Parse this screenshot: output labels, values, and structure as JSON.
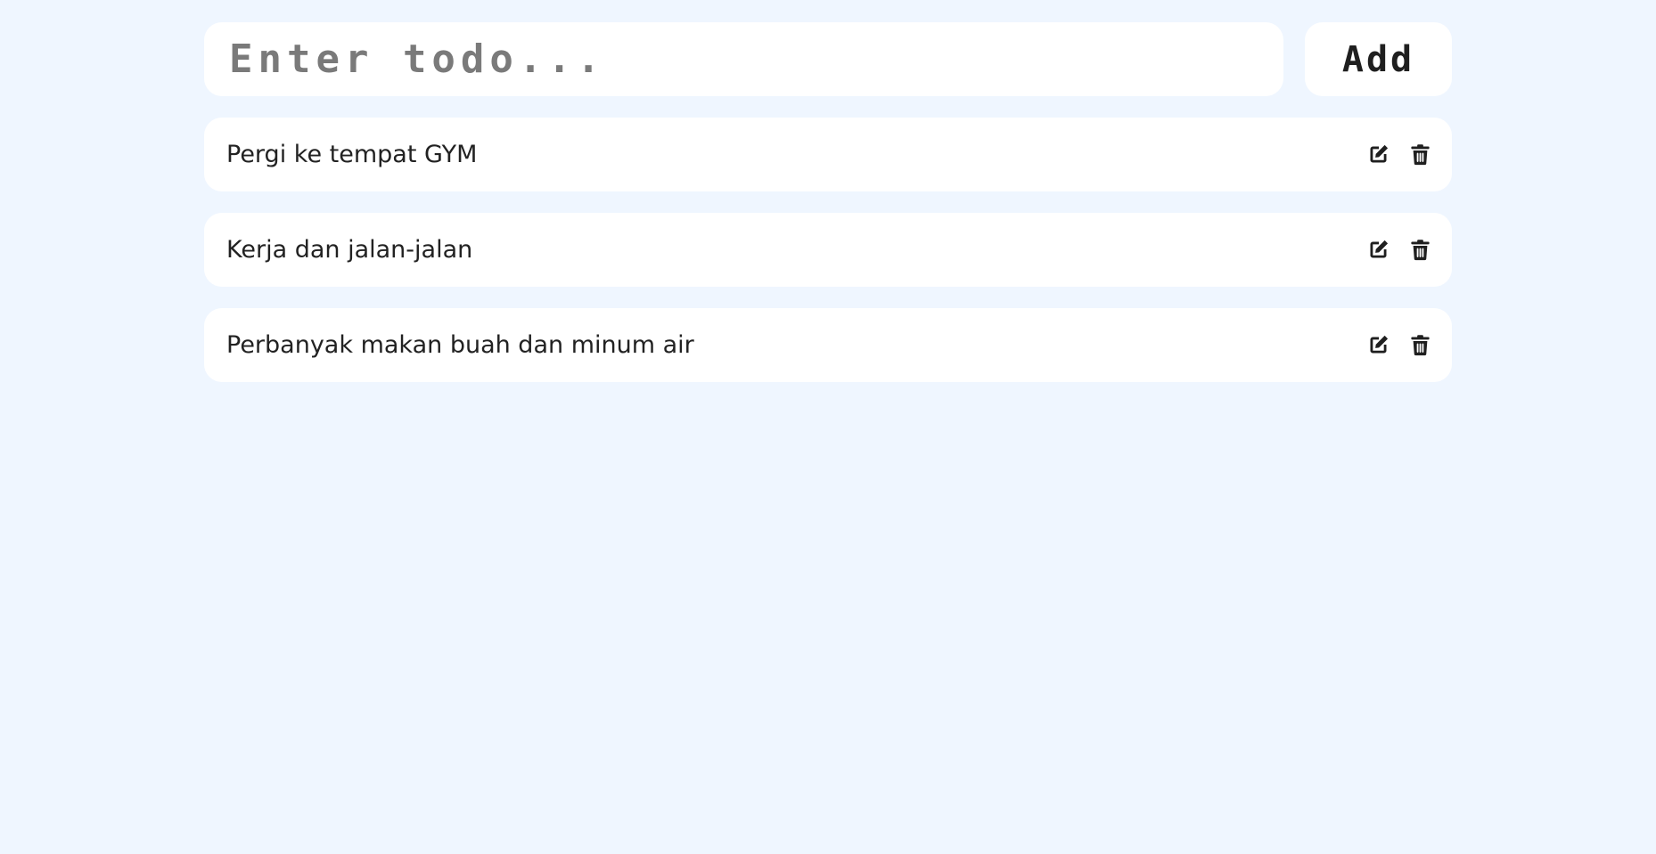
{
  "form": {
    "input_value": "",
    "input_placeholder": "Enter todo...",
    "add_label": "Add"
  },
  "todos": [
    {
      "text": "Pergi ke tempat GYM",
      "edit_icon": "edit-icon",
      "delete_icon": "trash-icon"
    },
    {
      "text": "Kerja dan jalan-jalan",
      "edit_icon": "edit-icon",
      "delete_icon": "trash-icon"
    },
    {
      "text": "Perbanyak makan buah dan minum air",
      "edit_icon": "edit-icon",
      "delete_icon": "trash-icon"
    }
  ],
  "colors": {
    "background": "#eff6ff",
    "card": "#ffffff",
    "text": "#1f1f1f",
    "placeholder": "#7a7a7a"
  }
}
